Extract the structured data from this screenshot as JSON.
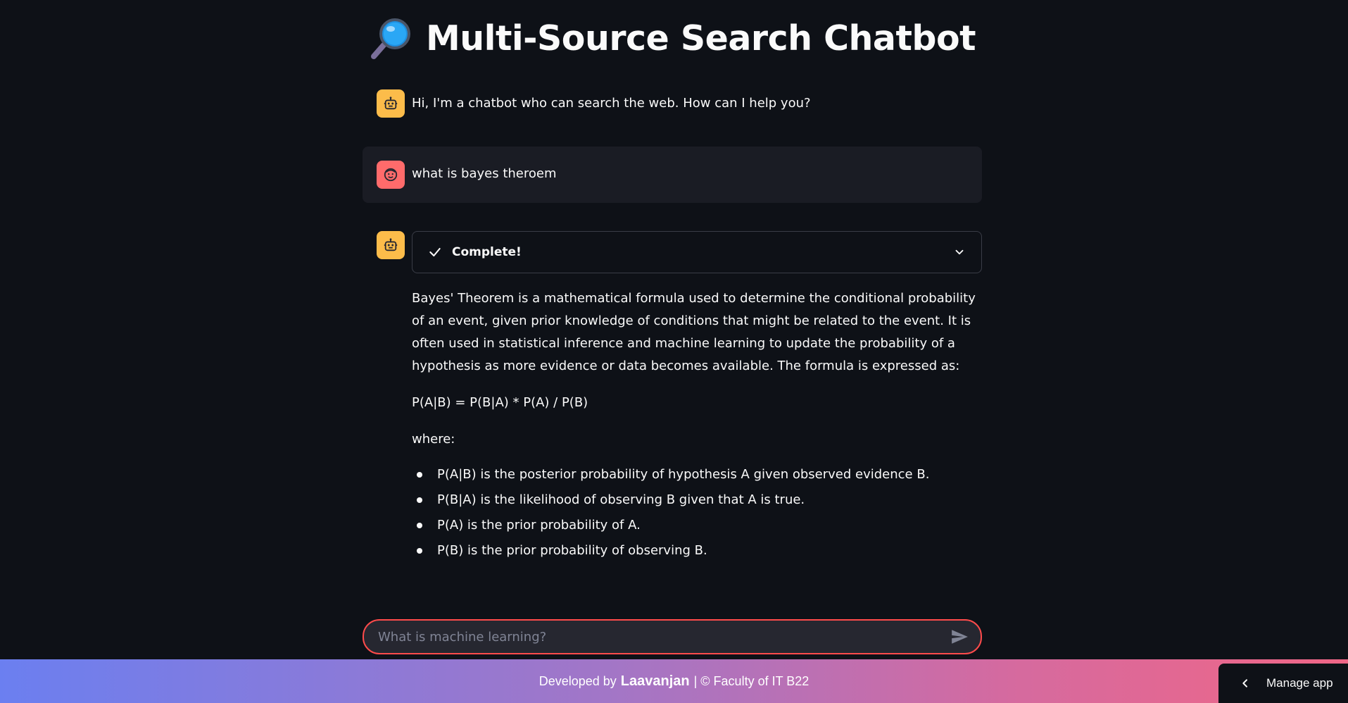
{
  "app": {
    "title": "Multi-Source Search Chatbot",
    "title_icon": "magnifying-glass-icon"
  },
  "messages": [
    {
      "role": "assistant",
      "avatar_icon": "robot-icon",
      "text": "Hi, I'm a chatbot who can search the web. How can I help you?"
    },
    {
      "role": "user",
      "avatar_icon": "smiley-face-icon",
      "text": "what is bayes theroem"
    },
    {
      "role": "assistant",
      "avatar_icon": "robot-icon",
      "status": {
        "icon": "checkmark-icon",
        "label": "Complete!",
        "toggle_icon": "chevron-down-icon"
      },
      "paragraph_1": "Bayes' Theorem is a mathematical formula used to determine the conditional probability of an event, given prior knowledge of conditions that might be related to the event. It is often used in statistical inference and machine learning to update the probability of a hypothesis as more evidence or data becomes available. The formula is expressed as:",
      "formula": "P(A|B) = P(B|A) * P(A) / P(B)",
      "where_label": "where:",
      "bullets": [
        "P(A|B) is the posterior probability of hypothesis A given observed evidence B.",
        "P(B|A) is the likelihood of observing B given that A is true.",
        "P(A) is the prior probability of A.",
        "P(B) is the prior probability of observing B."
      ]
    }
  ],
  "chat_input": {
    "placeholder": "What is machine learning?",
    "send_icon": "send-arrow-icon"
  },
  "footer": {
    "prefix": "Developed by",
    "author": "Laavanjan",
    "suffix": "| © Faculty of IT B22"
  },
  "manage_app": {
    "label": "Manage app",
    "icon": "chevron-left-icon"
  },
  "colors": {
    "background": "#0e1117",
    "bot_avatar": "#fcbc4a",
    "user_avatar": "#ff6b6b",
    "input_border": "#ff4b4b",
    "footer_gradient_start": "#6b7ff0",
    "footer_gradient_end": "#f06686"
  }
}
